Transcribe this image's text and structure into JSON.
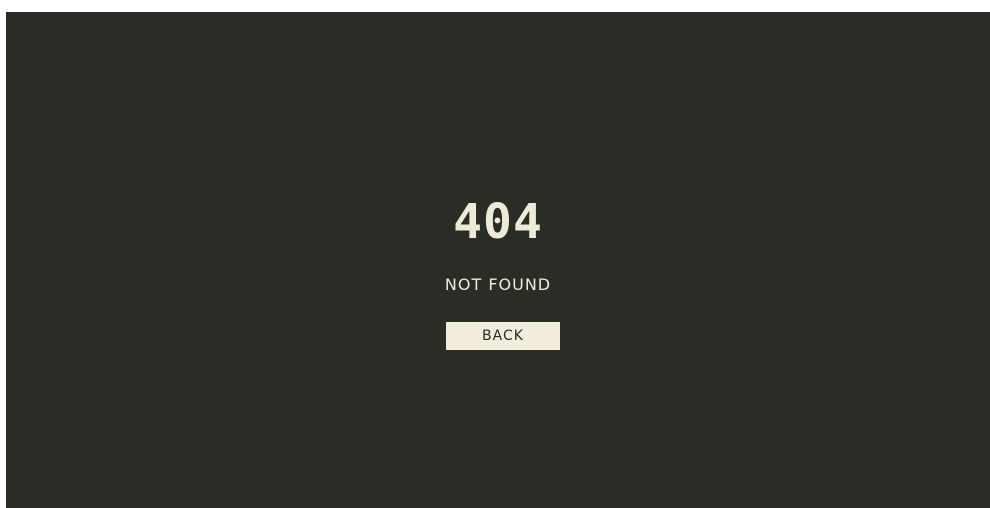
{
  "error": {
    "code": "404",
    "message": "NOT FOUND",
    "back_label": "BACK"
  },
  "colors": {
    "background": "#2a2c26",
    "text": "#eeead8",
    "button_bg": "#f1ecdb"
  }
}
